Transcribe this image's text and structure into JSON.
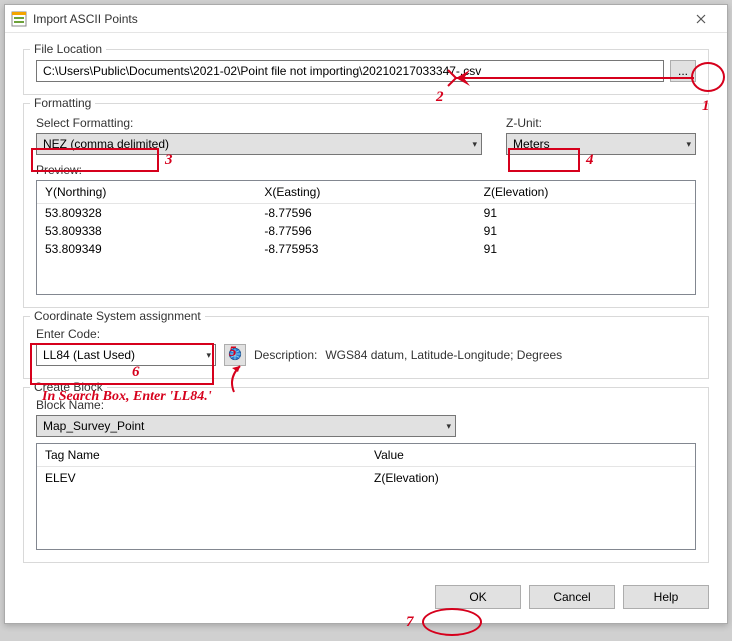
{
  "window": {
    "title": "Import ASCII Points"
  },
  "file_location": {
    "group_label": "File Location",
    "path": "C:\\Users\\Public\\Documents\\2021-02\\Point file not importing\\20210217033347-.csv",
    "browse_label": "..."
  },
  "formatting": {
    "group_label": "Formatting",
    "select_label": "Select Formatting:",
    "select_value": "NEZ (comma delimited)",
    "zunit_label": "Z-Unit:",
    "zunit_value": "Meters",
    "preview_label": "Preview:",
    "headers": {
      "c0": "Y(Northing)",
      "c1": "X(Easting)",
      "c2": "Z(Elevation)"
    },
    "rows": [
      {
        "c0": "53.809328",
        "c1": "-8.77596",
        "c2": "91"
      },
      {
        "c0": "53.809338",
        "c1": "-8.77596",
        "c2": "91"
      },
      {
        "c0": "53.809349",
        "c1": "-8.775953",
        "c2": "91"
      }
    ]
  },
  "cs": {
    "group_label": "Coordinate System assignment",
    "enter_code_label": "Enter Code:",
    "code_value": "LL84 (Last Used)",
    "desc_label": "Description:",
    "desc_value": "WGS84 datum, Latitude-Longitude; Degrees"
  },
  "block": {
    "group_label": "Create Block",
    "name_label": "Block Name:",
    "name_value": "Map_Survey_Point",
    "headers": {
      "c0": "Tag Name",
      "c1": "Value"
    },
    "rows": [
      {
        "c0": "ELEV",
        "c1": "Z(Elevation)"
      }
    ]
  },
  "footer": {
    "ok": "OK",
    "cancel": "Cancel",
    "help": "Help"
  },
  "annotations": {
    "a1": "1",
    "a2": "2",
    "a3": "3",
    "a4": "4",
    "a5": "5",
    "a6": "6",
    "a7": "7",
    "hint": "In Search Box, Enter 'LL84.'"
  }
}
